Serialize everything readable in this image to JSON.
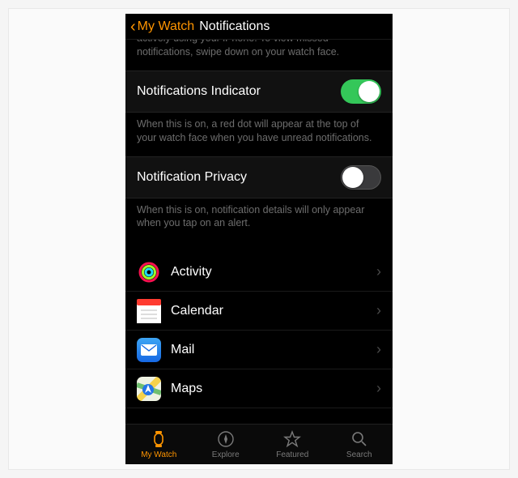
{
  "colors": {
    "accent": "#ff9500",
    "toggle_on": "#34c759"
  },
  "nav": {
    "back_label": "My Watch",
    "title": "Notifications"
  },
  "top_footer": "actively using your iPhone. To view missed notifications, swipe down on your watch face.",
  "settings": [
    {
      "label": "Notifications Indicator",
      "on": true,
      "footer": "When this is on, a red dot will appear at the top of your watch face when you have unread notifications."
    },
    {
      "label": "Notification Privacy",
      "on": false,
      "footer": "When this is on, notification details will only appear when you tap on an alert."
    }
  ],
  "apps": [
    {
      "label": "Activity",
      "icon": "activity-rings-icon"
    },
    {
      "label": "Calendar",
      "icon": "calendar-icon"
    },
    {
      "label": "Mail",
      "icon": "mail-icon"
    },
    {
      "label": "Maps",
      "icon": "maps-icon"
    }
  ],
  "tabs": [
    {
      "label": "My Watch",
      "icon": "watch-icon",
      "active": true
    },
    {
      "label": "Explore",
      "icon": "compass-icon",
      "active": false
    },
    {
      "label": "Featured",
      "icon": "star-icon",
      "active": false
    },
    {
      "label": "Search",
      "icon": "search-icon",
      "active": false
    }
  ]
}
